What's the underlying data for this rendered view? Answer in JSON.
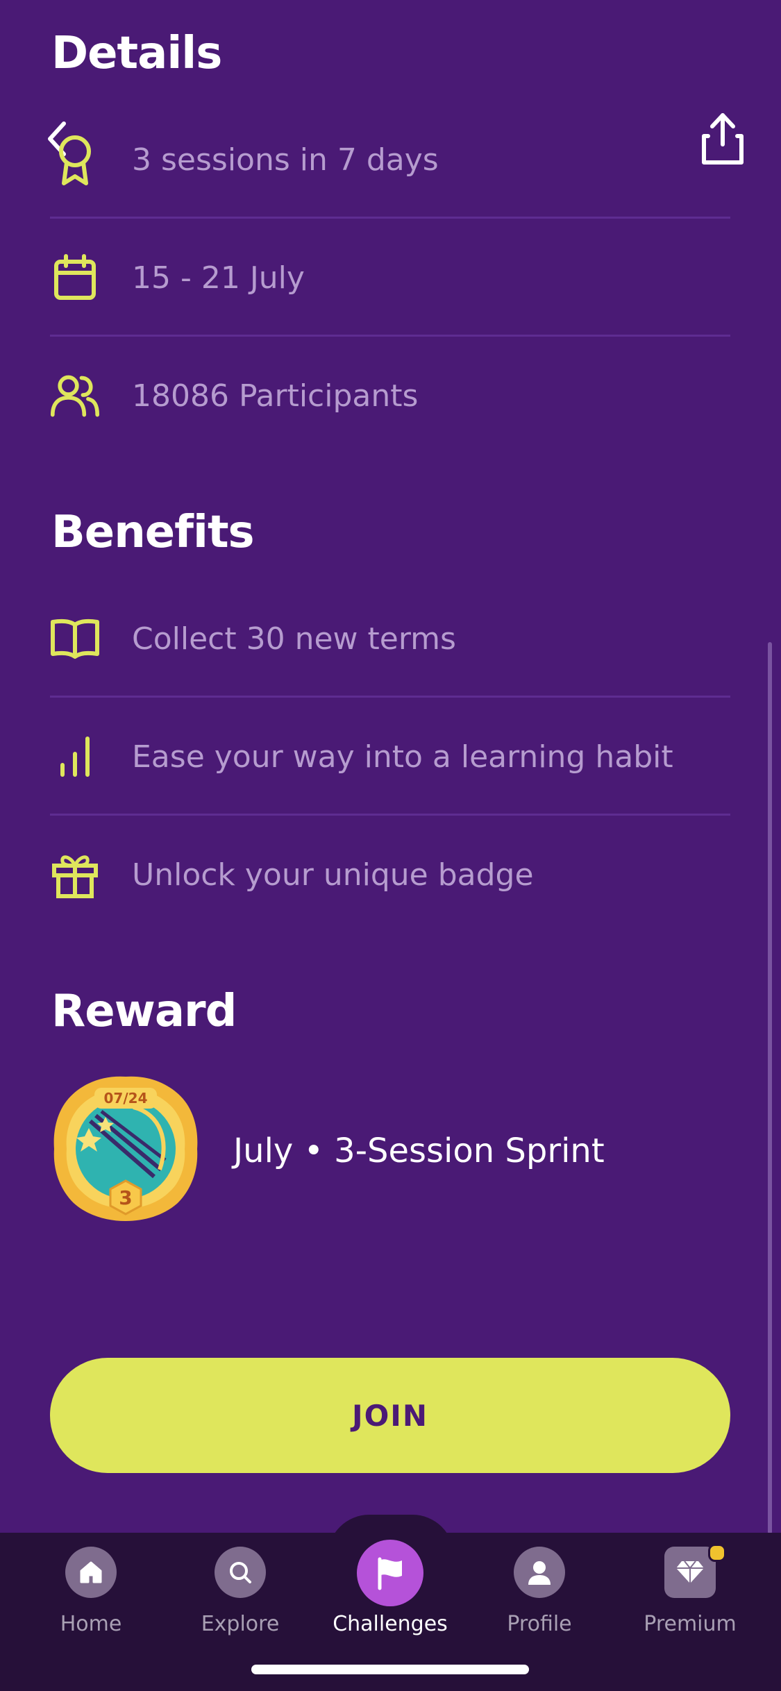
{
  "details": {
    "title": "Details",
    "items": [
      {
        "icon": "award-ribbon-icon",
        "text": "3 sessions in 7 days"
      },
      {
        "icon": "calendar-icon",
        "text": "15 - 21 July"
      },
      {
        "icon": "participants-icon",
        "text": "18086 Participants"
      }
    ]
  },
  "benefits": {
    "title": "Benefits",
    "items": [
      {
        "icon": "book-icon",
        "text": "Collect 30 new terms"
      },
      {
        "icon": "bar-chart-icon",
        "text": "Ease your way into a learning habit"
      },
      {
        "icon": "gift-icon",
        "text": "Unlock your unique badge"
      }
    ]
  },
  "reward": {
    "title": "Reward",
    "badge_date": "07/24",
    "badge_number": "3",
    "name": "July • 3-Session Sprint"
  },
  "join_label": "JOIN",
  "tabs": [
    {
      "label": "Home",
      "icon": "home-icon"
    },
    {
      "label": "Explore",
      "icon": "search-icon"
    },
    {
      "label": "Challenges",
      "icon": "flag-icon",
      "active": true
    },
    {
      "label": "Profile",
      "icon": "profile-icon"
    },
    {
      "label": "Premium",
      "icon": "diamond-icon"
    }
  ],
  "colors": {
    "background": "#4a1a75",
    "accent_yellow": "#dfe65c",
    "active_tab": "#b552d9",
    "muted_text": "#b69ccf",
    "tabbar": "#261039"
  }
}
